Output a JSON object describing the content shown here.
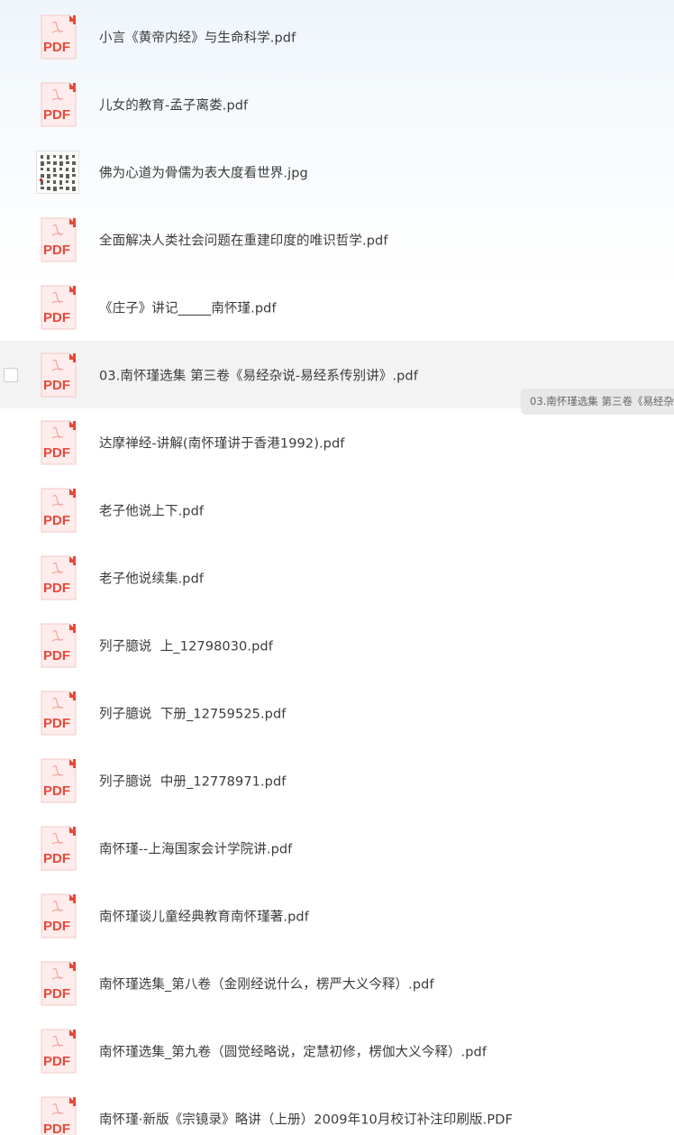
{
  "files": [
    {
      "name": "小言《黄帝内经》与生命科学.pdf",
      "icon": "pdf-icon",
      "icon_label": "PDF"
    },
    {
      "name": "儿女的教育-孟子离娄.pdf",
      "icon": "pdf-icon",
      "icon_label": "PDF"
    },
    {
      "name": "佛为心道为骨儒为表大度看世界.jpg",
      "icon": "image-thumbnail",
      "icon_label": ""
    },
    {
      "name": "全面解决人类社会问题在重建印度的唯识哲学.pdf",
      "icon": "pdf-icon",
      "icon_label": "PDF"
    },
    {
      "name": "《庄子》讲记_____南怀瑾.pdf",
      "icon": "pdf-icon",
      "icon_label": "PDF"
    },
    {
      "name": "03.南怀瑾选集 第三卷《易经杂说-易经系传别讲》.pdf",
      "icon": "pdf-icon",
      "icon_label": "PDF"
    },
    {
      "name": "达摩禅经-讲解(南怀瑾讲于香港1992).pdf",
      "icon": "pdf-icon",
      "icon_label": "PDF"
    },
    {
      "name": "老子他说上下.pdf",
      "icon": "pdf-icon",
      "icon_label": "PDF"
    },
    {
      "name": "老子他说续集.pdf",
      "icon": "pdf-icon",
      "icon_label": "PDF"
    },
    {
      "name": "列子臆说  上_12798030.pdf",
      "icon": "pdf-icon",
      "icon_label": "PDF"
    },
    {
      "name": "列子臆说  下册_12759525.pdf",
      "icon": "pdf-icon",
      "icon_label": "PDF"
    },
    {
      "name": "列子臆说  中册_12778971.pdf",
      "icon": "pdf-icon",
      "icon_label": "PDF"
    },
    {
      "name": "南怀瑾--上海国家会计学院讲.pdf",
      "icon": "pdf-icon",
      "icon_label": "PDF"
    },
    {
      "name": "南怀瑾谈儿童经典教育南怀瑾著.pdf",
      "icon": "pdf-icon",
      "icon_label": "PDF"
    },
    {
      "name": "南怀瑾选集_第八卷（金刚经说什么，楞严大义今释）.pdf",
      "icon": "pdf-icon",
      "icon_label": "PDF"
    },
    {
      "name": "南怀瑾选集_第九卷（圆觉经略说，定慧初修，楞伽大义今释）.pdf",
      "icon": "pdf-icon",
      "icon_label": "PDF"
    },
    {
      "name": "南怀瑾·新版《宗镜录》略讲（上册）2009年10月校订补注印刷版.PDF",
      "icon": "pdf-icon",
      "icon_label": "PDF"
    }
  ],
  "hovered_index": 5,
  "tooltip": {
    "text": "03.南怀瑾选集 第三卷《易经杂"
  },
  "colors": {
    "pdf_red": "#e8483a",
    "pdf_bg": "#fdeceb",
    "hover_bg": "#f3f3f4",
    "text": "#3b3b3b"
  }
}
